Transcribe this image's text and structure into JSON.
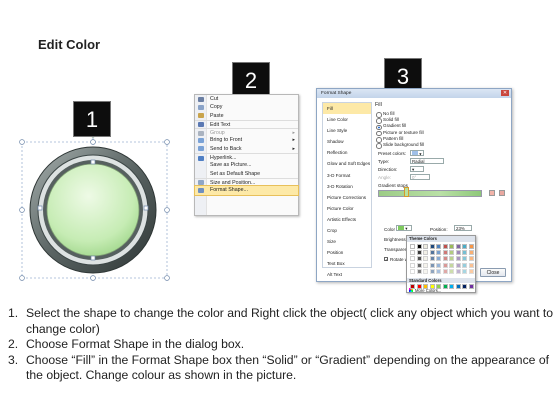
{
  "title": "Edit Color",
  "badges": {
    "one": "1",
    "two": "2",
    "three": "3"
  },
  "context_menu": {
    "items": [
      {
        "label": "Cut",
        "icon": "scissors-icon"
      },
      {
        "label": "Copy",
        "icon": "copy-icon"
      },
      {
        "label": "Paste",
        "icon": "paste-icon"
      },
      {
        "label": "Edit Text",
        "icon": "edit-text-icon"
      },
      {
        "label": "Group",
        "icon": "group-icon"
      },
      {
        "label": "Bring to Front",
        "icon": "bring-front-icon"
      },
      {
        "label": "Send to Back",
        "icon": "send-back-icon"
      },
      {
        "label": "Hyperlink...",
        "icon": "hyperlink-icon"
      },
      {
        "label": "Save as Picture...",
        "icon": ""
      },
      {
        "label": "Set as Default Shape",
        "icon": ""
      },
      {
        "label": "Size and Position...",
        "icon": "size-position-icon"
      },
      {
        "label": "Format Shape...",
        "icon": "format-shape-icon"
      }
    ]
  },
  "dialog": {
    "title": "Format Shape",
    "close_label": "Close",
    "sidebar": [
      "Fill",
      "Line Color",
      "Line Style",
      "Shadow",
      "Reflection",
      "Glow and Soft Edges",
      "3-D Format",
      "3-D Rotation",
      "Picture Corrections",
      "Picture Color",
      "Artistic Effects",
      "Crop",
      "Size",
      "Position",
      "Text Box",
      "Alt Text"
    ],
    "fill_heading": "Fill",
    "fill_options": [
      "No fill",
      "Solid fill",
      "Gradient fill",
      "Picture or texture fill",
      "Pattern fill",
      "Slide background fill"
    ],
    "selected_fill": "Gradient fill",
    "preset_colors_label": "Preset colors:",
    "type_label": "Type:",
    "type_value": "Radial",
    "direction_label": "Direction:",
    "angle_label": "Angle:",
    "angle_value": "0°",
    "gradient_stops_label": "Gradient stops",
    "color_label": "Color",
    "position_label": "Position:",
    "position_value": "23%",
    "brightness_label": "Brightness",
    "transparency_label": "Transparency",
    "rotate_label": "Rotate with shape",
    "palette": {
      "theme_label": "Theme Colors",
      "standard_label": "Standard Colors",
      "more_label": "More Colors..."
    }
  },
  "steps": [
    {
      "num": "1.",
      "text": "Select the shape to change the color and Right click the object( click any object which you want to change color)"
    },
    {
      "num": "2.",
      "text": "Choose Format Shape in the dialog box."
    },
    {
      "num": "3.",
      "text": "Choose “Fill” in the Format Shape box then “Solid” or “Gradient” depending on the appearance of the object. Change colour as shown in the picture."
    }
  ],
  "colors": {
    "badge_bg": "#0d0d0d",
    "shape_fill": "#c6ecb4",
    "shape_ring": "#5f6b6a",
    "menu_highlight": "#fde9a7"
  }
}
